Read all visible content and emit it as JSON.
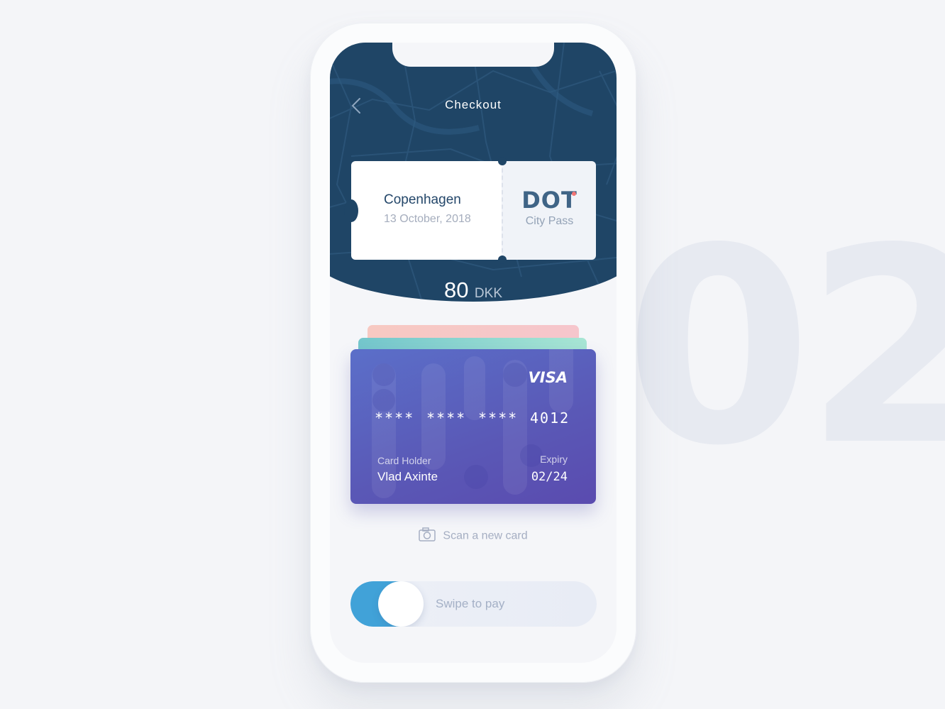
{
  "background": {
    "number": "02"
  },
  "header": {
    "title": "Checkout",
    "back_icon": "chevron-left-icon"
  },
  "ticket": {
    "city": "Copenhagen",
    "date": "13 October, 2018",
    "logo_text": "DOT",
    "pass_type": "City Pass"
  },
  "price": {
    "amount": "80",
    "currency": "DKK"
  },
  "card": {
    "brand": "VISA",
    "number_groups": [
      "****",
      "****",
      "****",
      "4012"
    ],
    "holder_label": "Card Holder",
    "holder_name": "Vlad Axinte",
    "expiry_label": "Expiry",
    "expiry": "02/24"
  },
  "scan": {
    "label": "Scan a new card",
    "icon": "camera-icon"
  },
  "swipe": {
    "label": "Swipe to pay"
  },
  "colors": {
    "header_bg": "#1f4566",
    "accent_blue": "#41a2d8",
    "card_purple": "#5a58b6",
    "logo_dot": "#f27575"
  }
}
